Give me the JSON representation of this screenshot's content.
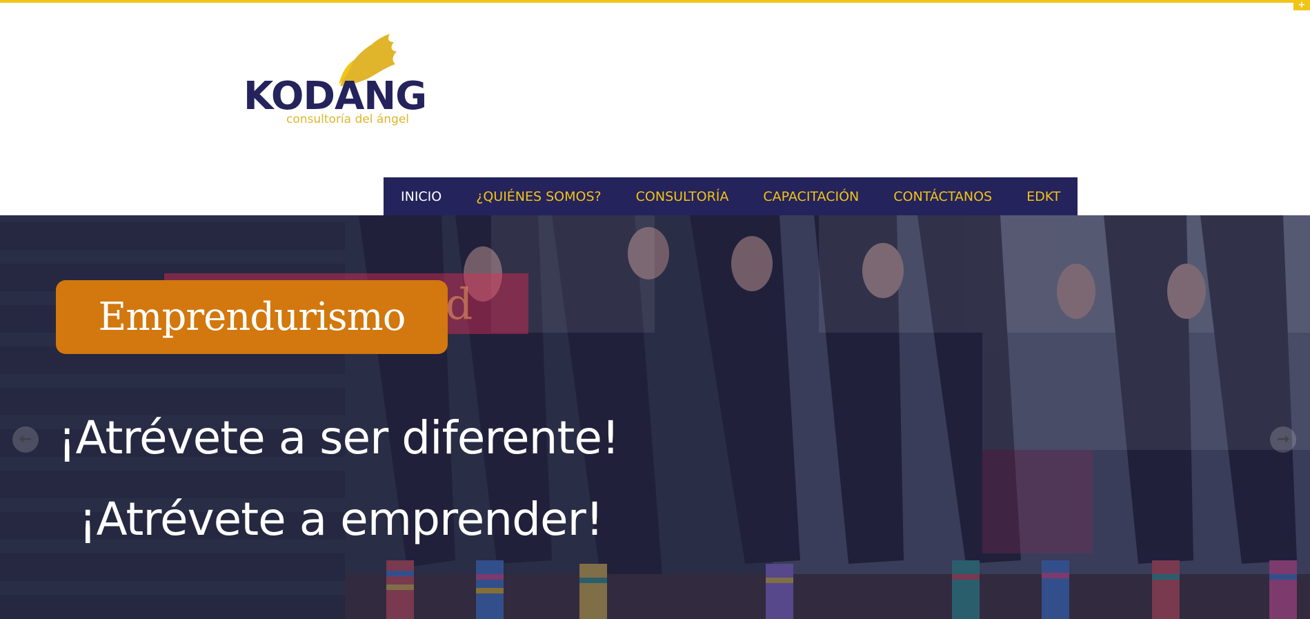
{
  "brand": {
    "name": "KODANG",
    "tagline": "consultoría del ángel",
    "colors": {
      "navy": "#24235c",
      "gold": "#f2c418",
      "orange": "#d2780e"
    }
  },
  "topbar": {
    "toggle_icon": "plus-icon",
    "toggle_label": "+"
  },
  "nav": {
    "items": [
      {
        "label": "INICIO",
        "active": true
      },
      {
        "label": "¿QUIÉNES SOMOS?",
        "active": false
      },
      {
        "label": "CONSULTORÍA",
        "active": false
      },
      {
        "label": "CAPACITACIÓN",
        "active": false
      },
      {
        "label": "CONTÁCTANOS",
        "active": false
      },
      {
        "label": "EDKT",
        "active": false
      }
    ]
  },
  "slider": {
    "badge": "Emprendurismo",
    "badge_ghost": "Creatividad",
    "headline_1": "¡Atrévete a ser diferente!",
    "headline_2": "¡Atrévete a emprender!",
    "prev_label": "←",
    "next_label": "→"
  }
}
